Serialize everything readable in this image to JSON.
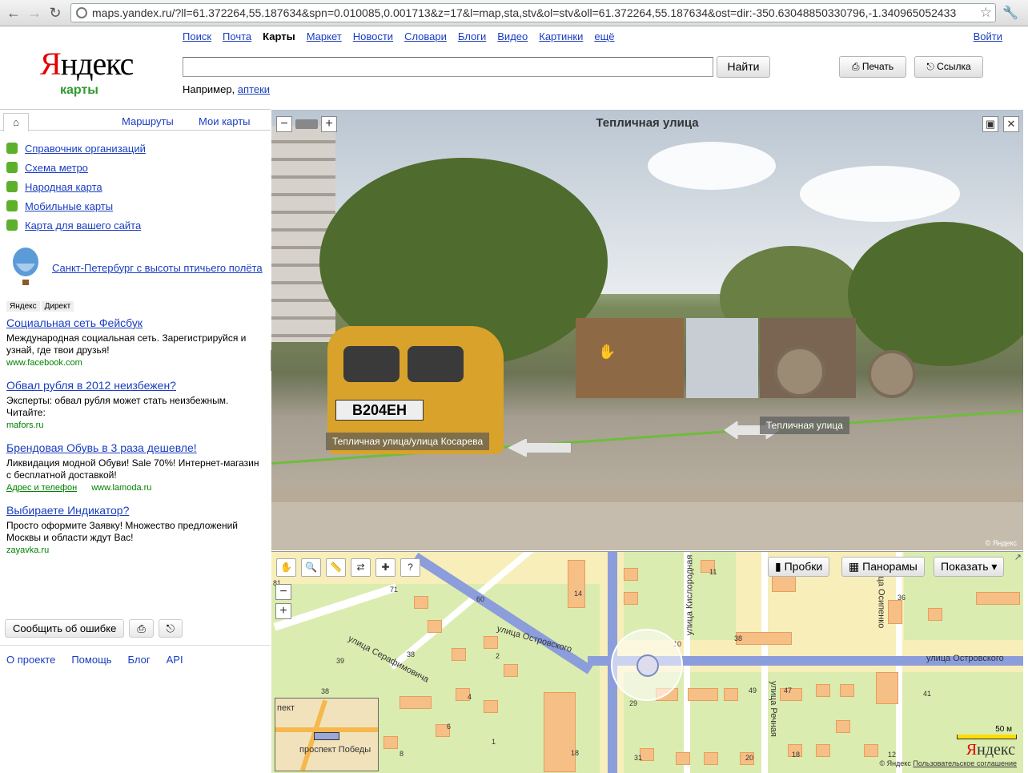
{
  "browser": {
    "url": "maps.yandex.ru/?ll=61.372264,55.187634&spn=0.010085,0.001713&z=17&l=map,sta,stv&ol=stv&oll=61.372264,55.187634&ost=dir:-350.63048850330796,-1.340965052433"
  },
  "header": {
    "logo_main": "ндекс",
    "logo_first": "Я",
    "logo_sub": "карты",
    "nav": [
      "Поиск",
      "Почта",
      "Карты",
      "Маркет",
      "Новости",
      "Словари",
      "Блоги",
      "Видео",
      "Картинки",
      "ещё"
    ],
    "nav_active_index": 2,
    "login": "Войти",
    "search_value": "",
    "search_button": "Найти",
    "example_prefix": "Например,",
    "example_link": "аптеки",
    "print_button": "Печать",
    "link_button": "Ссылка"
  },
  "sidebar": {
    "tabs": [
      "Маршруты",
      "Мои карты"
    ],
    "menu": [
      "Справочник организаций",
      "Схема метро",
      "Народная карта",
      "Мобильные карты",
      "Карта для вашего сайта"
    ],
    "promo": "Санкт-Петербург с высоты птичьего полёта",
    "ad_tags": [
      "Яндекс",
      "Директ"
    ],
    "ads": [
      {
        "title": "Социальная сеть Фейсбук",
        "text": "Международная социальная сеть. Зарегистрируйся и узнай, где твои друзья!",
        "url": "www.facebook.com"
      },
      {
        "title": "Обвал рубля в 2012 неизбежен?",
        "text": "Эксперты: обвал рубля может стать неизбежным. Читайте:",
        "url": "mafors.ru"
      },
      {
        "title": "Брендовая Обувь в 3 раза дешевле!",
        "text": "Ликвидация модной Обуви! Sale 70%! Интернет-магазин с бесплатной доставкой!",
        "link": "Адрес и телефон",
        "url": "www.lamoda.ru"
      },
      {
        "title": "Выбираете Индикатор?",
        "text": "Просто оформите Заявку! Множество предложений Москвы и области ждут Вас!",
        "url": "zayavka.ru"
      }
    ],
    "report_button": "Сообщить об ошибке",
    "footer": [
      "О проекте",
      "Помощь",
      "Блог",
      "API"
    ]
  },
  "panorama": {
    "title": "Тепличная улица",
    "labels": {
      "left": "Тепличная улица/улица Косарева",
      "right": "Тепличная улица"
    },
    "plate": "В204ЕН",
    "copyright": "© Яндекс"
  },
  "map": {
    "buttons": {
      "traffic": "Пробки",
      "panoramas": "Панорамы",
      "show": "Показать ▾"
    },
    "streets": {
      "ostrovsky_1": "улица Островского",
      "ostrovsky_2": "улица Островского",
      "serafimovicha": "улица Серафимовича",
      "kislorodnaya": "улица Кислородная",
      "osipenko": "улица Осипенко",
      "rechnaya": "улица Речная",
      "pobedy": "проспект Победы",
      "pekt": "пект"
    },
    "numbers": [
      "81",
      "71",
      "60",
      "14",
      "11",
      "12",
      "36",
      "39",
      "38",
      "2",
      "4",
      "6",
      "38",
      "10",
      "38",
      "49",
      "47",
      "41",
      "29",
      "18",
      "20",
      "18",
      "12",
      "31",
      "1",
      "8",
      "18"
    ],
    "scale": "50 м",
    "logo_first": "Я",
    "logo_main": "ндекс",
    "copyright": "© Яндекс",
    "agreement": "Пользовательское соглашение"
  }
}
